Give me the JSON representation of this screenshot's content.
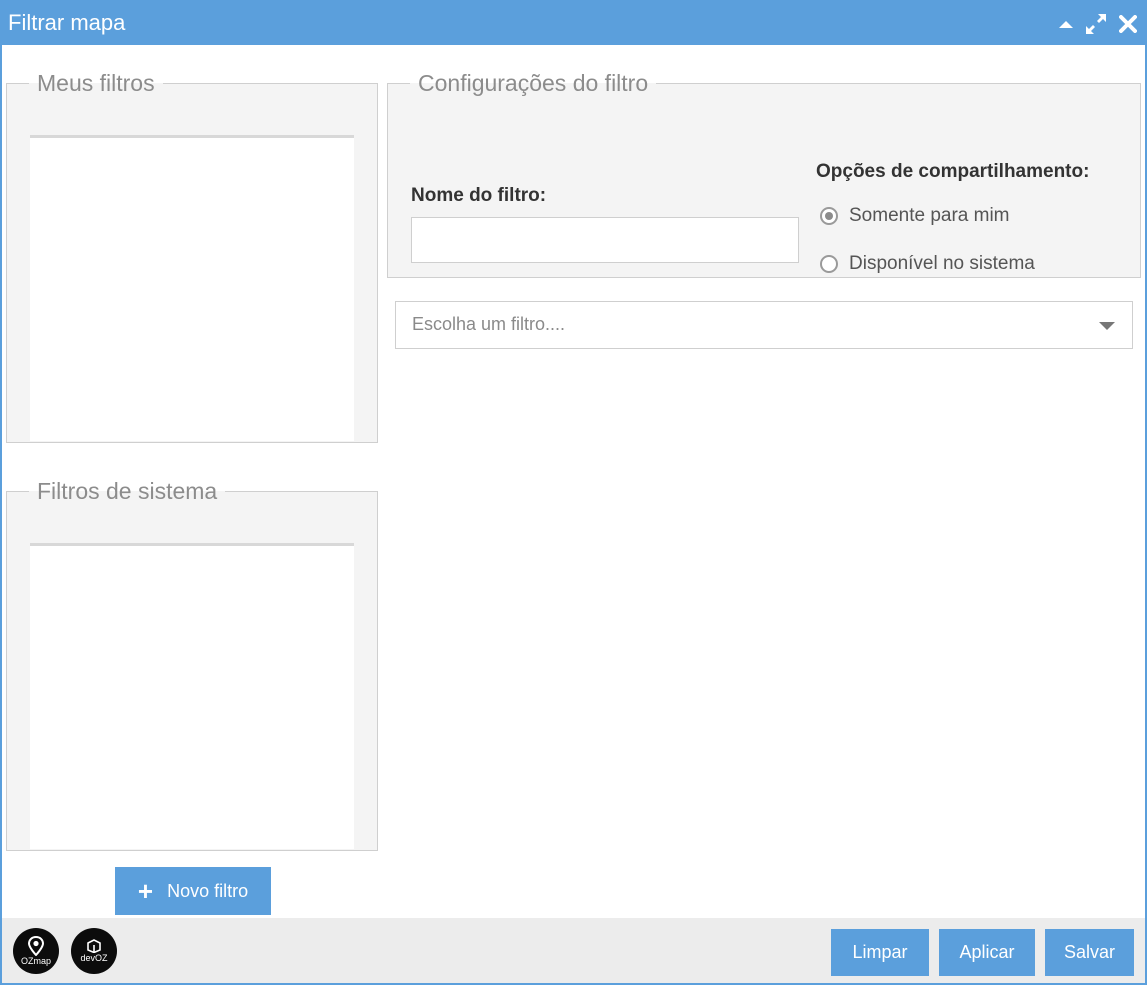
{
  "window": {
    "title": "Filtrar mapa",
    "accent_color": "#5b9fdc",
    "controls": {
      "collapse_icon": "caret-up-icon",
      "maximize_icon": "expand-icon",
      "close_icon": "close-icon"
    }
  },
  "my_filters": {
    "title": "Meus filtros",
    "items": []
  },
  "system_filters": {
    "title": "Filtros de sistema",
    "items": []
  },
  "config": {
    "title": "Configurações do filtro",
    "name_label": "Nome do filtro:",
    "name_value": "",
    "sharing_label": "Opções de compartilhamento:",
    "sharing_options": [
      {
        "label": "Somente para mim",
        "checked": true
      },
      {
        "label": "Disponível no sistema",
        "checked": false
      }
    ]
  },
  "filter_select": {
    "placeholder": "Escolha um filtro...."
  },
  "new_filter_button": "Novo filtro",
  "footer": {
    "logos": [
      {
        "name": "OZmap"
      },
      {
        "name": "devOZ"
      }
    ],
    "buttons": {
      "clear": "Limpar",
      "apply": "Aplicar",
      "save": "Salvar"
    }
  }
}
